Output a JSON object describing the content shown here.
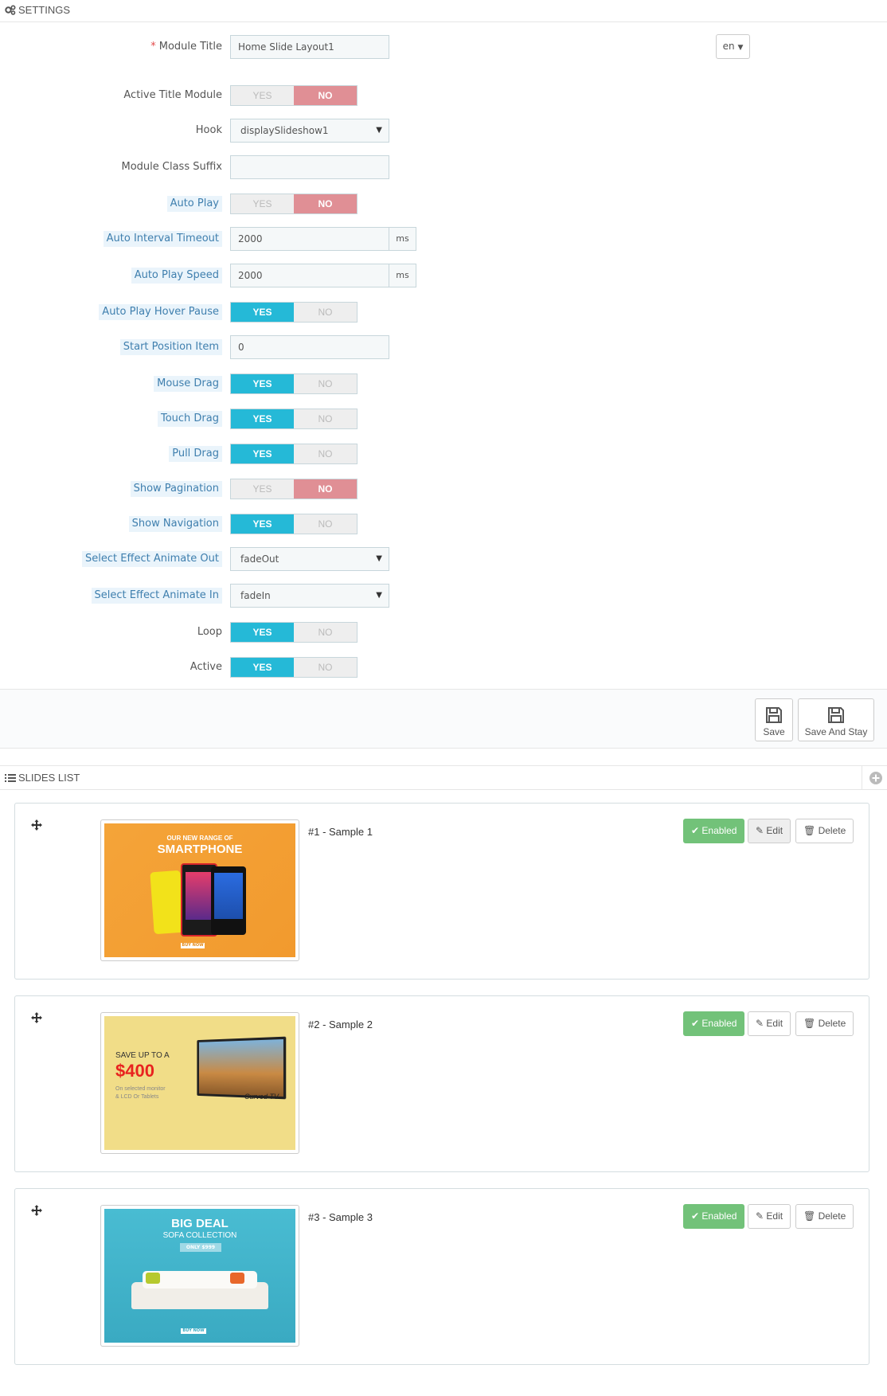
{
  "settings": {
    "title": "SETTINGS",
    "lang": "en",
    "yes_label": "YES",
    "no_label": "NO",
    "module_title": {
      "label": "Module Title",
      "value": "Home Slide Layout1"
    },
    "active_title": {
      "label": "Active Title Module",
      "value": "NO"
    },
    "hook": {
      "label": "Hook",
      "value": "displaySlideshow1"
    },
    "class_suffix": {
      "label": "Module Class Suffix",
      "value": ""
    },
    "auto_play": {
      "label": "Auto Play",
      "value": "NO"
    },
    "auto_interval": {
      "label": "Auto Interval Timeout",
      "value": "2000",
      "unit": "ms"
    },
    "auto_speed": {
      "label": "Auto Play Speed",
      "value": "2000",
      "unit": "ms"
    },
    "hover_pause": {
      "label": "Auto Play Hover Pause",
      "value": "YES"
    },
    "start_position": {
      "label": "Start Position Item",
      "value": "0"
    },
    "mouse_drag": {
      "label": "Mouse Drag",
      "value": "YES"
    },
    "touch_drag": {
      "label": "Touch Drag",
      "value": "YES"
    },
    "pull_drag": {
      "label": "Pull Drag",
      "value": "YES"
    },
    "show_pagination": {
      "label": "Show Pagination",
      "value": "NO"
    },
    "show_navigation": {
      "label": "Show Navigation",
      "value": "YES"
    },
    "effect_out": {
      "label": "Select Effect Animate Out",
      "value": "fadeOut"
    },
    "effect_in": {
      "label": "Select Effect Animate In",
      "value": "fadeIn"
    },
    "loop": {
      "label": "Loop",
      "value": "YES"
    },
    "active": {
      "label": "Active",
      "value": "YES"
    },
    "save_label": "Save",
    "save_stay_label": "Save And Stay"
  },
  "slides": {
    "title": "SLIDES LIST",
    "enabled_label": "Enabled",
    "edit_label": "Edit",
    "delete_label": "Delete",
    "items": [
      {
        "title": "#1 - Sample 1",
        "banner_line1": "OUR NEW RANGE OF",
        "banner_line2": "SMARTPHONE",
        "banner_cta": "BUY NOW"
      },
      {
        "title": "#2 - Sample 2",
        "banner_line1": "SAVE UP TO A",
        "banner_line2": "$400",
        "banner_line3": "On selected monitor",
        "banner_line4": "& LCD Or Tablets",
        "banner_tv": "Curved TV"
      },
      {
        "title": "#3 - Sample 3",
        "banner_line1": "BIG DEAL",
        "banner_line2": "SOFA COLLECTION",
        "banner_badge": "ONLY $999",
        "banner_cta": "BUY NOW"
      }
    ]
  },
  "colors": {
    "yes": "#25b9d7",
    "no": "#e08f95",
    "enabled": "#72c279",
    "hint_bg": "#eaf4fb",
    "hint_text": "#3f7fae"
  }
}
